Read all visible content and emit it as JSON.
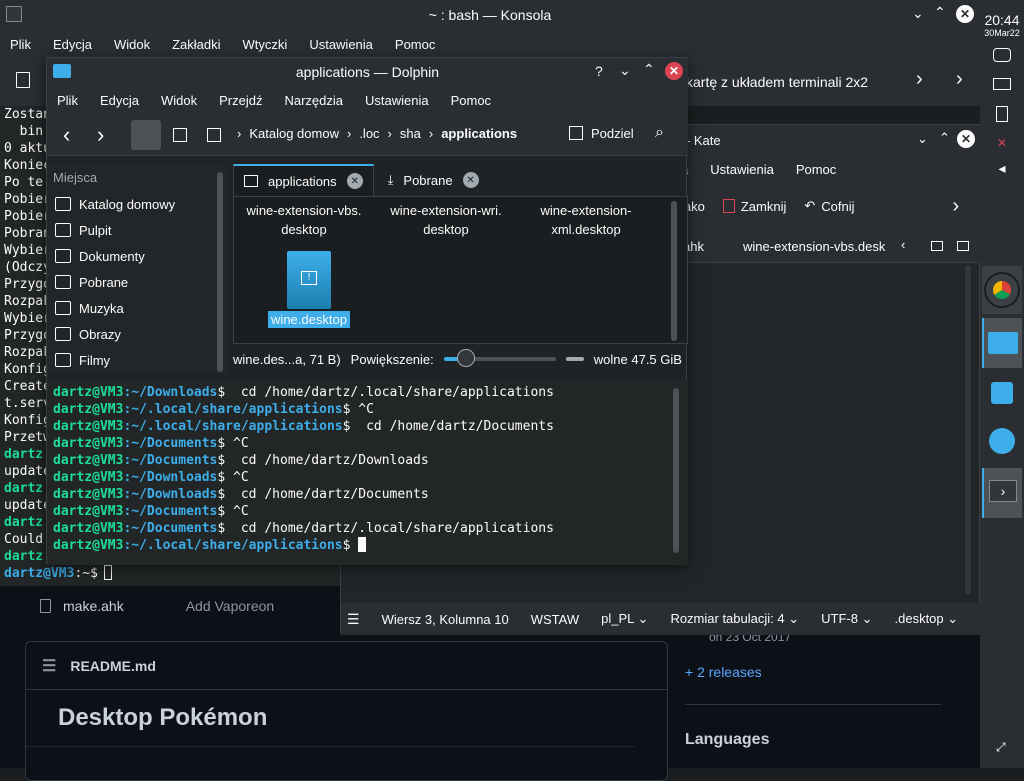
{
  "konsole": {
    "title": "~ : bash — Konsola",
    "menu": [
      "Plik",
      "Edycja",
      "Widok",
      "Zakładki",
      "Wtyczki",
      "Ustawienia",
      "Pomoc"
    ],
    "toolbar_right_label": "kartę z układem terminali 2x2",
    "terminal_lines": [
      "Zostan",
      "  bin",
      "0 aktu",
      "Koniec",
      "Po te",
      "Pobier",
      "Pobier",
      "Pobran",
      "Wybier",
      "(Odczy",
      "Przygo",
      "Rozpak",
      "Wybier",
      "Przygo",
      "Rozpak",
      "Konfig",
      "Create",
      "t.serv",
      "Konfig",
      "Przetw",
      "dartz",
      "update",
      "dartz",
      "update",
      "dartz",
      "Could",
      "dartz"
    ],
    "prompt_user": "dartz@VM3",
    "prompt_path": ":~$",
    "final_prompt": "dartz@VM3:~$"
  },
  "kate": {
    "title": "– Kate",
    "menu": [
      "a",
      "Ustawienia",
      "Pomoc"
    ],
    "toolbar": {
      "save_as": "jako",
      "close": "Zamknij",
      "undo": "Cofnij"
    },
    "tabs": [
      "ahk",
      "wine-extension-vbs.desk"
    ],
    "status": {
      "position": "Wiersz 3, Kolumna 10",
      "mode": "WSTAW",
      "language": "pl_PL",
      "tab_size": "Rozmiar tabulacji: 4",
      "encoding": "UTF-8",
      "filetype": ".desktop"
    }
  },
  "dolphin": {
    "title": "applications — Dolphin",
    "menu": [
      "Plik",
      "Edycja",
      "Widok",
      "Przejdź",
      "Narzędzia",
      "Ustawienia",
      "Pomoc"
    ],
    "breadcrumb": [
      "Katalog domow",
      ".loc",
      "sha",
      "applications"
    ],
    "split_label": "Podziel",
    "places_header": "Miejsca",
    "places": [
      {
        "label": "Katalog domowy",
        "icon": "home-icon"
      },
      {
        "label": "Pulpit",
        "icon": "desktop-icon"
      },
      {
        "label": "Dokumenty",
        "icon": "documents-icon"
      },
      {
        "label": "Pobrane",
        "icon": "downloads-icon"
      },
      {
        "label": "Muzyka",
        "icon": "music-icon"
      },
      {
        "label": "Obrazy",
        "icon": "pictures-icon"
      },
      {
        "label": "Filmy",
        "icon": "videos-icon"
      }
    ],
    "tabs": [
      {
        "label": "applications",
        "active": true
      },
      {
        "label": "Pobrane",
        "active": false
      }
    ],
    "files": [
      {
        "line1": "wine-extension-vbs.",
        "line2": "desktop"
      },
      {
        "line1": "wine-extension-wri.",
        "line2": "desktop"
      },
      {
        "line1": "wine-extension-",
        "line2": "xml.desktop"
      }
    ],
    "selected_file": "wine.desktop",
    "status": {
      "selection": "wine.des...a, 71 B)",
      "zoom_label": "Powiększenie:",
      "zoom_level": 0.2,
      "free_space": "wolne 47.5 GiB"
    },
    "terminal": [
      {
        "user": "dartz@VM3",
        "path": ":~/Downloads",
        "cmd": "$  cd /home/dartz/.local/share/applications"
      },
      {
        "user": "dartz@VM3",
        "path": ":~/.local/share/applications",
        "cmd": "$ ^C"
      },
      {
        "user": "dartz@VM3",
        "path": ":~/.local/share/applications",
        "cmd": "$  cd /home/dartz/Documents"
      },
      {
        "user": "dartz@VM3",
        "path": ":~/Documents",
        "cmd": "$ ^C"
      },
      {
        "user": "dartz@VM3",
        "path": ":~/Documents",
        "cmd": "$  cd /home/dartz/Downloads"
      },
      {
        "user": "dartz@VM3",
        "path": ":~/Downloads",
        "cmd": "$ ^C"
      },
      {
        "user": "dartz@VM3",
        "path": ":~/Downloads",
        "cmd": "$  cd /home/dartz/Documents"
      },
      {
        "user": "dartz@VM3",
        "path": ":~/Documents",
        "cmd": "$ ^C"
      },
      {
        "user": "dartz@VM3",
        "path": ":~/Documents",
        "cmd": "$  cd /home/dartz/.local/share/applications"
      },
      {
        "user": "dartz@VM3",
        "path": ":~/.local/share/applications",
        "cmd": "$ "
      }
    ]
  },
  "github": {
    "file_row": {
      "name": "make.ahk",
      "commit": "Add Vaporeon"
    },
    "readme_label": "README.md",
    "readme_title": "Desktop Pokémon",
    "side_date": "on 23 Oct 2017",
    "releases_link": "+ 2 releases",
    "languages_heading": "Languages"
  },
  "panel": {
    "time": "20:44",
    "date": "30Mar22"
  },
  "colors": {
    "accent": "#3daee9",
    "prompt_green": "#1cdc9a",
    "close_red": "#da4453"
  }
}
